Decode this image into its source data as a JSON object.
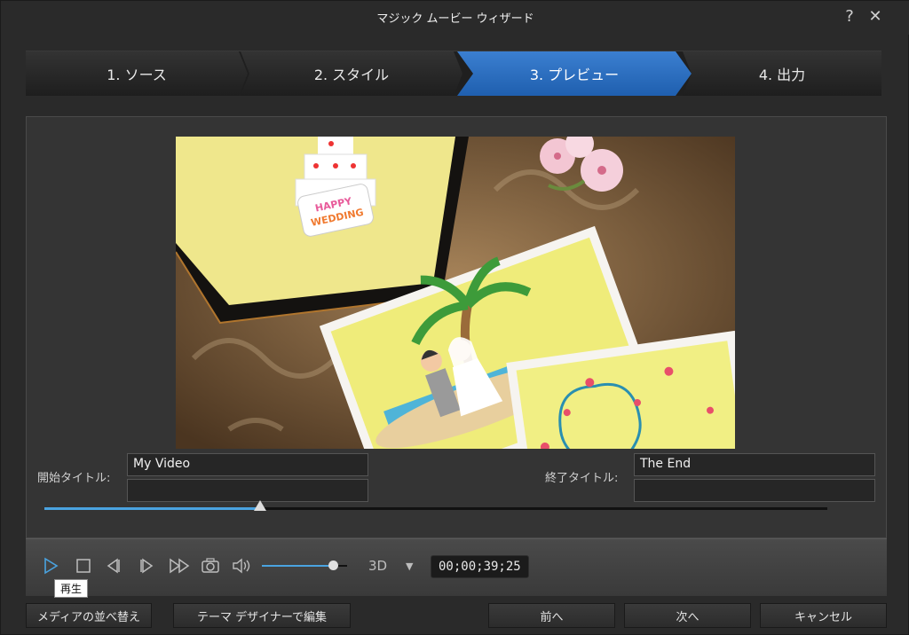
{
  "window": {
    "title": "マジック ムービー ウィザード",
    "help_label": "?",
    "close_label": "✕"
  },
  "steps": [
    {
      "label": "1. ソース"
    },
    {
      "label": "2. スタイル"
    },
    {
      "label": "3. プレビュー",
      "active": true
    },
    {
      "label": "4. 出力"
    }
  ],
  "preview": {
    "cake_text_line1": "HAPPY",
    "cake_text_line2": "WEDDING"
  },
  "titles": {
    "start_label": "開始タイトル:",
    "start_value_1": "My Video",
    "start_value_2": "",
    "end_label": "終了タイトル:",
    "end_value_1": "The End",
    "end_value_2": ""
  },
  "seek": {
    "progress": 0.275
  },
  "controls": {
    "volume": 0.85,
    "mode_label": "3D",
    "mode_arrow": "▼",
    "timecode": "00;00;39;25",
    "tooltip": "再生"
  },
  "icons": [
    "play-icon",
    "stop-icon",
    "prev-frame-icon",
    "next-frame-icon",
    "fast-forward-icon",
    "camera-icon",
    "volume-icon"
  ],
  "buttons": {
    "reorder": "メディアの並べ替え",
    "theme_designer": "テーマ デザイナーで編集",
    "back": "前へ",
    "next": "次へ",
    "cancel": "キャンセル"
  },
  "colors": {
    "accent": "#3b7fd0",
    "progress": "#4aa3e0"
  }
}
